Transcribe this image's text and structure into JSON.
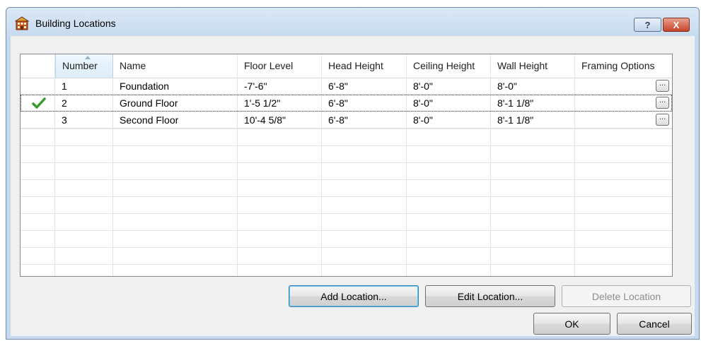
{
  "window": {
    "title": "Building Locations",
    "icon": "building-icon",
    "help_label": "?",
    "close_label": "X"
  },
  "grid": {
    "columns": [
      "Number",
      "Name",
      "Floor Level",
      "Head Height",
      "Ceiling Height",
      "Wall Height",
      "Framing Options"
    ],
    "sorted_column": "Number",
    "rows": [
      {
        "number": "1",
        "name": "Foundation",
        "floor_level": "-7'-6\"",
        "head_height": "6'-8\"",
        "ceiling_height": "8'-0\"",
        "wall_height": "8'-0\"",
        "framing_button": "...",
        "current": false
      },
      {
        "number": "2",
        "name": "Ground Floor",
        "floor_level": "1'-5 1/2\"",
        "head_height": "6'-8\"",
        "ceiling_height": "8'-0\"",
        "wall_height": "8'-1 1/8\"",
        "framing_button": "...",
        "current": true
      },
      {
        "number": "3",
        "name": "Second Floor",
        "floor_level": "10'-4 5/8\"",
        "head_height": "6'-8\"",
        "ceiling_height": "8'-0\"",
        "wall_height": "8'-1 1/8\"",
        "framing_button": "...",
        "current": false
      }
    ]
  },
  "buttons": {
    "add_location": "Add Location...",
    "edit_location": "Edit Location...",
    "delete_location": "Delete Location",
    "ok": "OK",
    "cancel": "Cancel"
  },
  "colors": {
    "title_bar": "#c7dbef",
    "close_button": "#c7432b",
    "check_mark": "#3a9a2e"
  }
}
